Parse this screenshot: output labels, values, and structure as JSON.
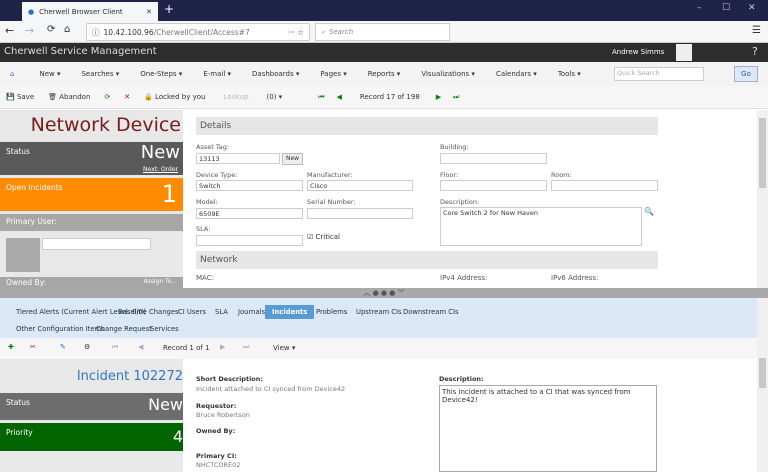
{
  "browser": {
    "tab_title": "Cherwell Browser Client",
    "url_host": "10.42.100.96",
    "url_path": "/CherwellClient/Access#7",
    "search_placeholder": "Search"
  },
  "app": {
    "title": "Cherwell Service Management",
    "user": "Andrew Simms"
  },
  "menu": [
    "New ▾",
    "Searches ▾",
    "One-Steps ▾",
    "E-mail ▾",
    "Dashboards ▾",
    "Pages ▾",
    "Reports ▾",
    "Visualizations ▾",
    "Calendars ▾",
    "Tools ▾"
  ],
  "quick_search": {
    "placeholder": "Quick Search",
    "go": "Go"
  },
  "toolbar": {
    "save": "Save",
    "abandon": "Abandon",
    "locked": "Locked by you",
    "lookup": "Lookup",
    "attachments": "(0) ▾",
    "record": "Record 17 of 198"
  },
  "left": {
    "title": "Network Device",
    "status_label": "Status",
    "status_value": "New",
    "next_order": "Next: Order",
    "open_incidents_label": "Open Incidents",
    "open_incidents_value": "1",
    "primary_user": "Primary User:",
    "owned_by": "Owned By:",
    "assign_to": "Assign To..."
  },
  "details": {
    "header": "Details",
    "asset_tag_label": "Asset Tag:",
    "asset_tag": "13113",
    "new_btn": "New",
    "building_label": "Building:",
    "device_type_label": "Device Type:",
    "device_type": "Switch",
    "manufacturer_label": "Manufacturer:",
    "manufacturer": "Cisco",
    "floor_label": "Floor:",
    "room_label": "Room:",
    "model_label": "Model:",
    "model": "6509E",
    "serial_label": "Serial Number:",
    "description_label": "Description:",
    "description": "Core Switch 2 for New Haven",
    "sla_label": "SLA:",
    "critical_label": "Critical",
    "critical_checked": true
  },
  "network": {
    "header": "Network",
    "mac_label": "MAC:",
    "ipv4_label": "IPv4 Address:",
    "ipv6_label": "IPv6 Address:"
  },
  "tabs": [
    "Tiered Alerts (Current Alert Level: 0/0)",
    "Baseline Changes",
    "CI Users",
    "SLA",
    "Journals",
    "Incidents",
    "Problems",
    "Upstream CIs",
    "Downstream CIs",
    "Other Configuration Items",
    "Change Request",
    "Services"
  ],
  "active_tab": "Incidents",
  "sub_toolbar": {
    "record": "Record 1 of 1",
    "view": "View ▾"
  },
  "incident": {
    "title": "Incident 102272",
    "status_label": "Status",
    "status_value": "New",
    "priority_label": "Priority",
    "priority_value": "4",
    "short_desc_label": "Short Description:",
    "short_desc": "Incident attached to CI synced from Device42",
    "requestor_label": "Requestor:",
    "requestor": "Bruce Robertson",
    "owned_by_label": "Owned By:",
    "primary_ci_label": "Primary CI:",
    "primary_ci": "NHCTCORE02",
    "description_label": "Description:",
    "description": "This incident is attached to a CI that was synced from Device42!"
  },
  "colors": {
    "orange": "#ff8c00",
    "green": "#006400",
    "dark_red": "#7a1a1a",
    "status_gray": "#5a5a5a",
    "incident_blue": "#2a7ac8"
  }
}
